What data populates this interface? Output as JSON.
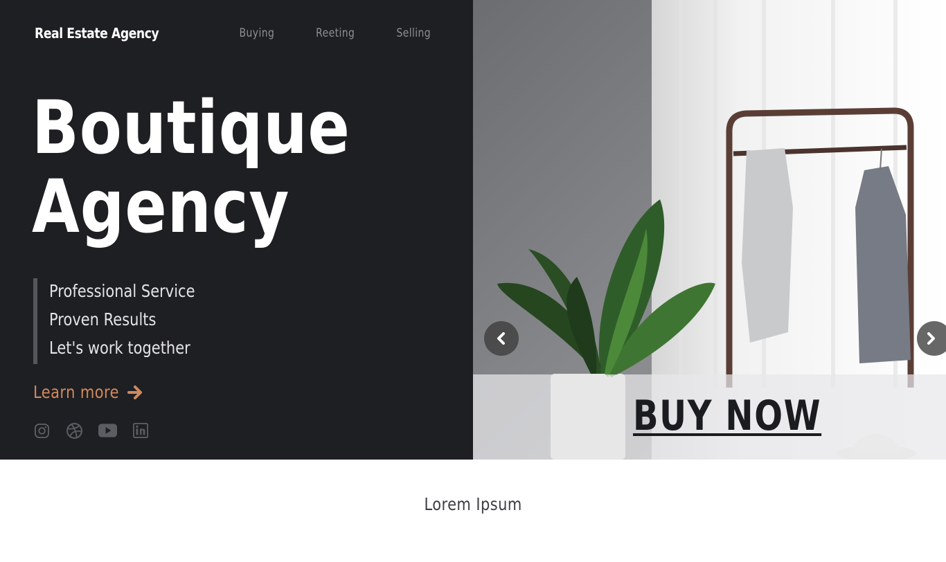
{
  "header": {
    "brand": "Real Estate Agency",
    "nav": [
      "Buying",
      "Reeting",
      "Selling"
    ]
  },
  "hero": {
    "title_line1": "Boutique",
    "title_line2": "Agency",
    "features": [
      "Professional Service",
      "Proven Results",
      "Let's work together"
    ],
    "learn_more": "Learn more",
    "social_icons": [
      "instagram-icon",
      "dribbble-icon",
      "youtube-icon",
      "linkedin-icon"
    ]
  },
  "slider": {
    "cta": "BUY NOW",
    "prev_icon": "chevron-left-icon",
    "next_icon": "chevron-right-icon"
  },
  "section": {
    "heading": "Lorem Ipsum"
  },
  "colors": {
    "dark_bg": "#1e1f23",
    "accent": "#d1895e",
    "muted_text": "#8e8f95"
  }
}
